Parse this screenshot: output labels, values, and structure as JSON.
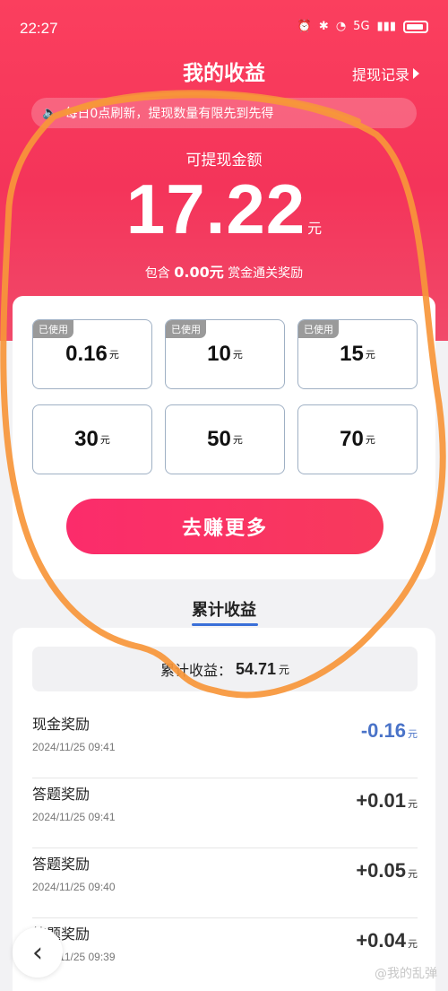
{
  "status": {
    "time": "22:27",
    "net": "5G"
  },
  "header": {
    "title": "我的收益",
    "withdraw_record": "提现记录"
  },
  "notice": {
    "text": "每日0点刷新，提现数量有限先到先得"
  },
  "balance": {
    "label": "可提现金额",
    "amount": "17.22",
    "unit": "元",
    "included_prefix": "包含",
    "included_amount": "0.00元",
    "included_suffix": "赏金通关奖励"
  },
  "options": [
    {
      "value": "0.16",
      "unit": "元",
      "tag": "已使用"
    },
    {
      "value": "10",
      "unit": "元",
      "tag": "已使用"
    },
    {
      "value": "15",
      "unit": "元",
      "tag": "已使用"
    },
    {
      "value": "30",
      "unit": "元",
      "tag": ""
    },
    {
      "value": "50",
      "unit": "元",
      "tag": ""
    },
    {
      "value": "70",
      "unit": "元",
      "tag": ""
    }
  ],
  "earn_more_button": "去赚更多",
  "section": {
    "title": "累计收益"
  },
  "total": {
    "label": "累计收益：",
    "value": "54.71",
    "unit": "元"
  },
  "records": [
    {
      "name": "现金奖励",
      "time": "2024/11/25 09:41",
      "amount": "-0.16",
      "unit": "元"
    },
    {
      "name": "答题奖励",
      "time": "2024/11/25 09:41",
      "amount": "+0.01",
      "unit": "元"
    },
    {
      "name": "答题奖励",
      "time": "2024/11/25 09:40",
      "amount": "+0.05",
      "unit": "元"
    },
    {
      "name": "答题奖励",
      "time": "2024/11/25 09:39",
      "amount": "+0.04",
      "unit": "元"
    }
  ],
  "watermark": "@我的乱弹",
  "colors": {
    "brand": "#f4345a",
    "negative": "#4a73c8",
    "annotation": "#f7963a"
  }
}
